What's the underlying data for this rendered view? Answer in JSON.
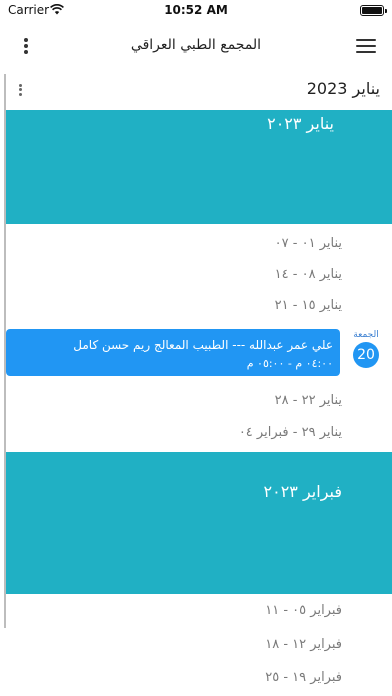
{
  "status_bar": {
    "carrier": "Carrier",
    "time": "10:52 AM",
    "battery_level": 1.0
  },
  "nav": {
    "title": "المجمع الطبي العراقي"
  },
  "calendar": {
    "current_month": "يناير 2023"
  },
  "months": [
    {
      "banner": "يناير ٢٠٢٣",
      "weeks": [
        "يناير ٠١ - ٠٧",
        "يناير ٠٨ - ١٤",
        "يناير ١٥ - ٢١"
      ],
      "event": {
        "day_name": "الجمعة",
        "day_number": "20",
        "title": "علي عمر عبدالله  --- الطبيب المعالج ريم حسن كامل",
        "time": "٠٤:٠٠ م - ٠٥:٠٠ م"
      },
      "weeks_after": [
        "يناير ٢٢ - ٢٨",
        "يناير ٢٩ - فبراير ٠٤"
      ]
    },
    {
      "banner": "فبراير ٢٠٢٣",
      "weeks": [
        "فبراير ٠٥ - ١١",
        "فبراير ١٢ - ١٨",
        "فبراير ١٩ - ٢٥"
      ]
    }
  ],
  "colors": {
    "banner": "#20b0c4",
    "event": "#2196f3",
    "day_label": "#3b7fd1"
  }
}
